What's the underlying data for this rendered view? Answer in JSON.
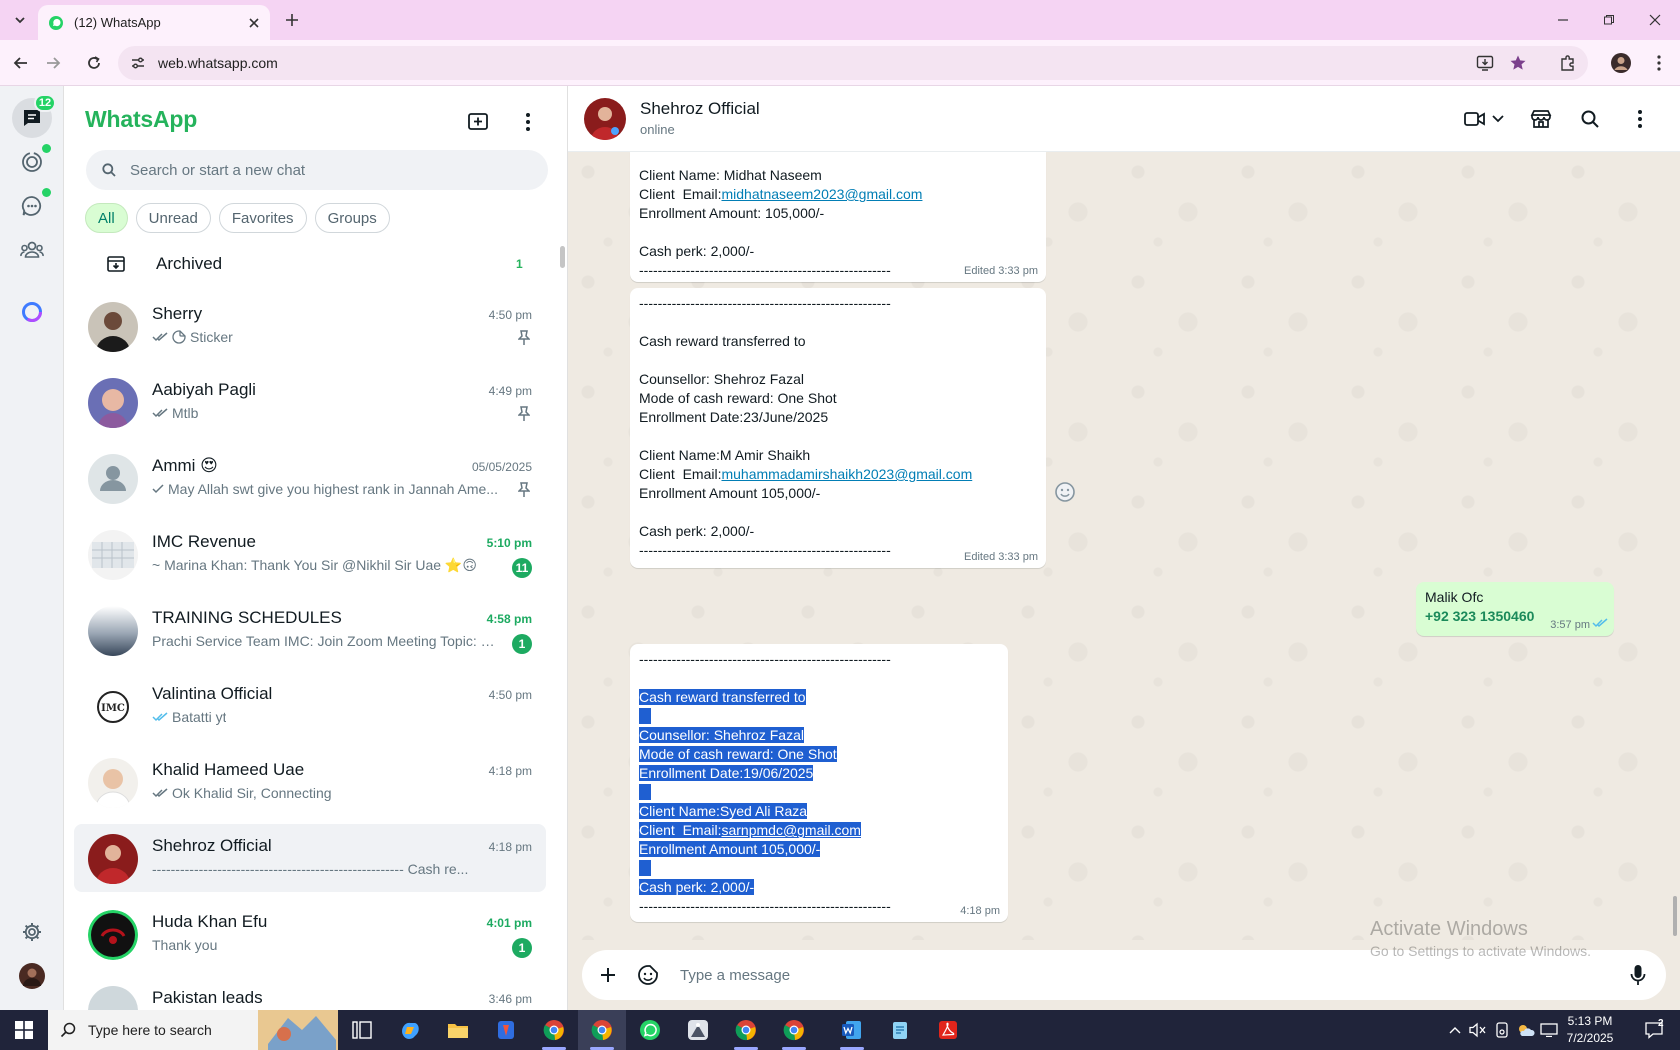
{
  "browser": {
    "tab_title": "(12) WhatsApp",
    "url": "web.whatsapp.com"
  },
  "rail": {
    "chats_badge": "12"
  },
  "sidebar": {
    "brand": "WhatsApp",
    "search_placeholder": "Search or start a new chat",
    "filters": [
      "All",
      "Unread",
      "Favorites",
      "Groups"
    ],
    "archived_label": "Archived",
    "archived_count": "1",
    "chats": [
      {
        "name": "Sherry",
        "time": "4:50 pm",
        "preview": "Sticker",
        "ticks": "double-grey",
        "pinned": true,
        "unread": ""
      },
      {
        "name": "Aabiyah Pagli",
        "time": "4:49 pm",
        "preview": "Mtlb",
        "ticks": "double-grey",
        "pinned": true,
        "unread": ""
      },
      {
        "name": "Ammi 😍",
        "time": "05/05/2025",
        "preview": "May Allah swt give you highest rank in Jannah  Ame...",
        "ticks": "single",
        "pinned": true,
        "unread": ""
      },
      {
        "name": "IMC Revenue",
        "time": "5:10 pm",
        "preview": "~ Marina Khan: Thank You Sir @Nikhil Sir Uae ⭐🙃",
        "ticks": "",
        "pinned": false,
        "unread": "11"
      },
      {
        "name": "TRAINING SCHEDULES",
        "time": "4:58 pm",
        "preview": "Prachi Service Team IMC: Join Zoom Meeting Topic: PM...",
        "ticks": "",
        "pinned": false,
        "unread": "1"
      },
      {
        "name": "Valintina Official",
        "time": "4:50 pm",
        "preview": "Batatti yt",
        "ticks": "double-blue",
        "pinned": false,
        "unread": ""
      },
      {
        "name": "Khalid Hameed Uae",
        "time": "4:18 pm",
        "preview": "Ok Khalid Sir, Connecting",
        "ticks": "double-grey",
        "pinned": false,
        "unread": ""
      },
      {
        "name": "Shehroz Official",
        "time": "4:18 pm",
        "preview": "------------------------------------------------------ Cash re...",
        "ticks": "",
        "pinned": false,
        "unread": ""
      },
      {
        "name": "Huda Khan Efu",
        "time": "4:01 pm",
        "preview": "Thank you",
        "ticks": "",
        "pinned": false,
        "unread": "1"
      },
      {
        "name": "Pakistan leads",
        "time": "3:46 pm",
        "preview": "",
        "ticks": "",
        "pinned": false,
        "unread": ""
      }
    ]
  },
  "conversation": {
    "name": "Shehroz Official",
    "status": "online",
    "messages": [
      {
        "lines": [
          "Client Name: Midhat Naseem",
          "Client  Email:|midhatnaseem2023@gmail.com",
          "Enrollment Amount: 105,000/-",
          "",
          "Cash perk: 2,000/-",
          "------------------------------------------------------"
        ],
        "meta": "Edited 3:33 pm"
      },
      {
        "lines": [
          "------------------------------------------------------",
          "",
          "Cash reward transferred to",
          "",
          "Counsellor: Shehroz Fazal",
          "Mode of cash reward: One Shot",
          "Enrollment Date:23/June/2025",
          "",
          "Client Name:M Amir Shaikh",
          "Client  Email:|muhammadamirshaikh2023@gmail.com",
          "Enrollment Amount 105,000/-",
          "",
          "Cash perk: 2,000/-",
          "------------------------------------------------------"
        ],
        "meta": "Edited 3:33 pm"
      },
      {
        "contact_name": "Malik Ofc",
        "contact_phone": "+92 323 1350460",
        "meta": "3:57 pm"
      },
      {
        "lines": [
          "------------------------------------------------------",
          "",
          "Cash reward transferred to",
          "",
          "Counsellor: Shehroz Fazal",
          "Mode of cash reward: One Shot",
          "Enrollment Date:19/06/2025",
          "",
          "Client Name:Syed Ali Raza",
          "Client  Email:|sarnpmdc@gmail.com",
          "Enrollment Amount 105,000/-",
          "",
          "Cash perk: 2,000/-",
          "------------------------------------------------------"
        ],
        "meta": "4:18 pm"
      }
    ],
    "composer_placeholder": "Type a message"
  },
  "watermark": {
    "line1": "Activate Windows",
    "line2": "Go to Settings to activate Windows."
  },
  "taskbar": {
    "search_placeholder": "Type here to search",
    "time": "5:13 PM",
    "date": "7/2/2025"
  },
  "colors": {
    "whatsapp_green": "#25b35c",
    "unread_green": "#1daa61",
    "outgoing_bubble": "#d9fdd3",
    "chat_bg": "#efeae2",
    "selection": "#1f5fd1",
    "tabbar": "#f5d4f3"
  }
}
